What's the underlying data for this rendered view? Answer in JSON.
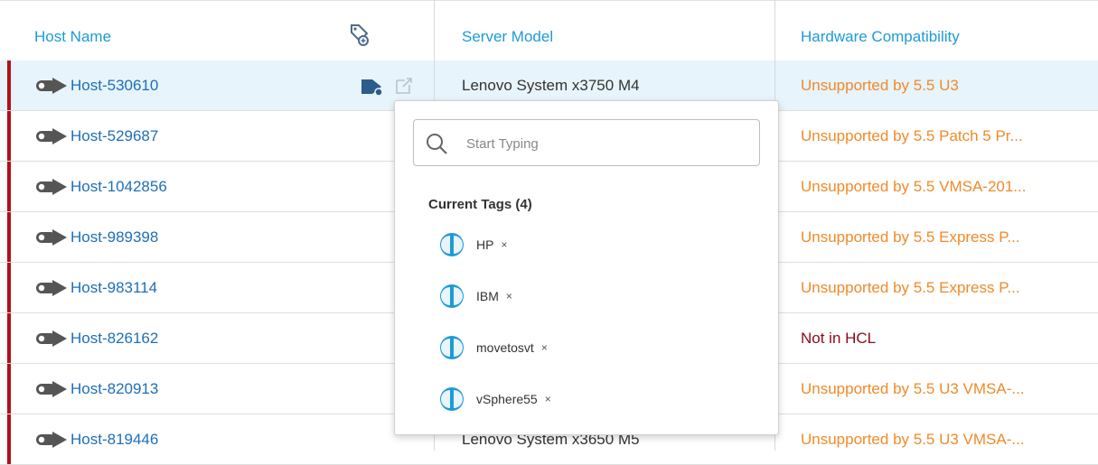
{
  "columns": {
    "host_name": "Host Name",
    "server_model": "Server Model",
    "hardware_compatibility": "Hardware Compatibility"
  },
  "rows": [
    {
      "host": "Host-530610",
      "model": "Lenovo System x3750 M4",
      "compat": "Unsupported by 5.5 U3",
      "compat_status": "warning"
    },
    {
      "host": "Host-529687",
      "model": "",
      "compat": "Unsupported by 5.5 Patch 5 Pr...",
      "compat_status": "warning"
    },
    {
      "host": "Host-1042856",
      "model": "",
      "compat": "Unsupported by 5.5 VMSA-201...",
      "compat_status": "warning"
    },
    {
      "host": "Host-989398",
      "model": "",
      "compat": "Unsupported by 5.5 Express P...",
      "compat_status": "warning"
    },
    {
      "host": "Host-983114",
      "model": "",
      "compat": "Unsupported by 5.5 Express P...",
      "compat_status": "warning"
    },
    {
      "host": "Host-826162",
      "model": "",
      "compat": "Not in HCL",
      "compat_status": "error"
    },
    {
      "host": "Host-820913",
      "model": "",
      "compat": "Unsupported by 5.5 U3 VMSA-...",
      "compat_status": "warning"
    },
    {
      "host": "Host-819446",
      "model": "Lenovo System x3650 M5",
      "compat": "Unsupported by 5.5 U3 VMSA-...",
      "compat_status": "warning"
    }
  ],
  "tag_popup": {
    "search_placeholder": "Start Typing",
    "current_tags_heading": "Current Tags (4)",
    "tags": [
      {
        "name": "HP",
        "remove": "×"
      },
      {
        "name": "IBM",
        "remove": "×"
      },
      {
        "name": "movetosvt",
        "remove": "×"
      },
      {
        "name": "vSphere55",
        "remove": "×"
      }
    ]
  },
  "colors": {
    "link": "#1d6fb8",
    "header": "#1d9ad8",
    "warning": "#f08a2a",
    "error": "#8b0a1a",
    "status_bar": "#b0121b",
    "selected_row": "#e7f4fb"
  },
  "icons": {
    "host": "host-toggle-icon",
    "header_tag": "tag-add-icon",
    "row_tag": "tag-icon",
    "row_edit": "edit-external-icon",
    "search": "search-icon",
    "tag": "tag-category-icon"
  }
}
